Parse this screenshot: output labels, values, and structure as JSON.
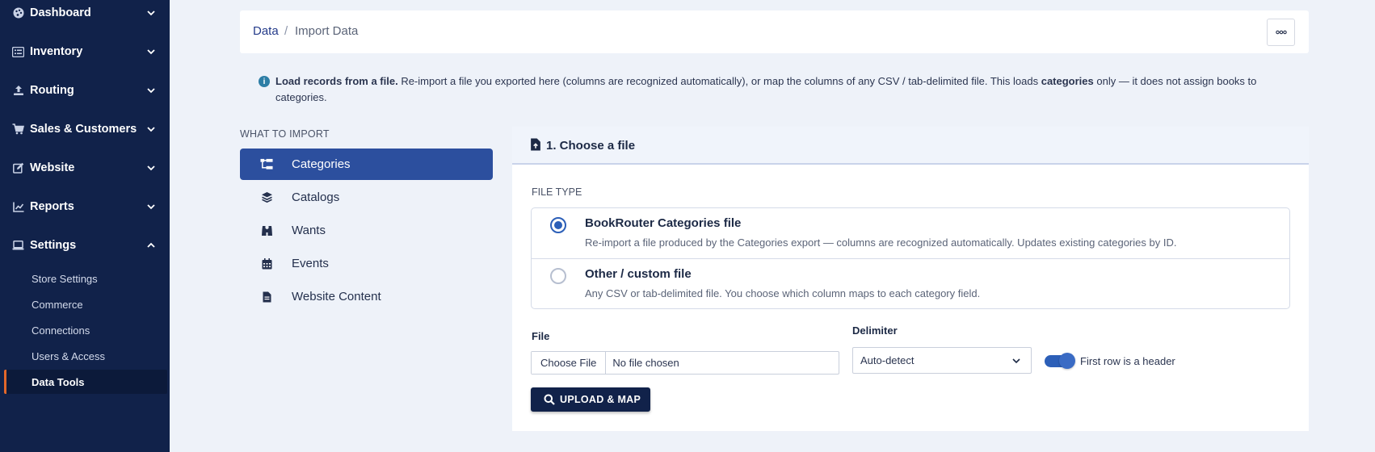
{
  "sidebar": {
    "items": [
      {
        "label": "Dashboard",
        "icon": "palette-icon",
        "expanded": false
      },
      {
        "label": "Inventory",
        "icon": "list-icon",
        "expanded": false
      },
      {
        "label": "Routing",
        "icon": "upload-icon",
        "expanded": false
      },
      {
        "label": "Sales & Customers",
        "icon": "cart-icon",
        "expanded": false
      },
      {
        "label": "Website",
        "icon": "edit-icon",
        "expanded": false
      },
      {
        "label": "Reports",
        "icon": "chart-icon",
        "expanded": false
      },
      {
        "label": "Settings",
        "icon": "laptop-icon",
        "expanded": true
      }
    ],
    "sub_items": [
      {
        "label": "Store Settings",
        "active": false
      },
      {
        "label": "Commerce",
        "active": false
      },
      {
        "label": "Connections",
        "active": false
      },
      {
        "label": "Users & Access",
        "active": false
      },
      {
        "label": "Data Tools",
        "active": true
      }
    ],
    "bg_color": "#11224a",
    "accent_color": "#e2672a"
  },
  "breadcrumb": {
    "link": "Data",
    "separator": "/",
    "current": "Import Data"
  },
  "info": {
    "icon": "info-icon",
    "bold_lead": "Load records from a file.",
    "text_1": " Re-import a file you exported here (columns are recognized automatically), or map the columns of any CSV / tab-delimited file. This loads ",
    "bold_word": "categories",
    "text_2": " only — it does not assign books to categories."
  },
  "what_to_import": {
    "title": "WHAT TO IMPORT",
    "items": [
      {
        "label": "Categories",
        "icon": "sitemap-icon",
        "active": true
      },
      {
        "label": "Catalogs",
        "icon": "layers-icon",
        "active": false
      },
      {
        "label": "Wants",
        "icon": "binoculars-icon",
        "active": false
      },
      {
        "label": "Events",
        "icon": "calendar-icon",
        "active": false
      },
      {
        "label": "Website Content",
        "icon": "document-icon",
        "active": false
      }
    ]
  },
  "step": {
    "title": "1. Choose a file",
    "icon": "file-upload-icon",
    "file_type_label": "FILE TYPE",
    "options": [
      {
        "title": "BookRouter Categories file",
        "description": "Re-import a file produced by the Categories export — columns are recognized automatically. Updates existing categories by ID.",
        "selected": true
      },
      {
        "title": "Other / custom file",
        "description": "Any CSV or tab-delimited file. You choose which column maps to each category field.",
        "selected": false
      }
    ],
    "file_label": "File",
    "file_button": "Choose File",
    "file_status": "No file chosen",
    "delimiter_label": "Delimiter",
    "delimiter_value": "Auto-detect",
    "header_toggle_label": "First row is a header",
    "header_toggle_on": true,
    "upload_button": "UPLOAD & MAP"
  },
  "colors": {
    "primary": "#2c4f9e",
    "dark": "#11224a"
  }
}
